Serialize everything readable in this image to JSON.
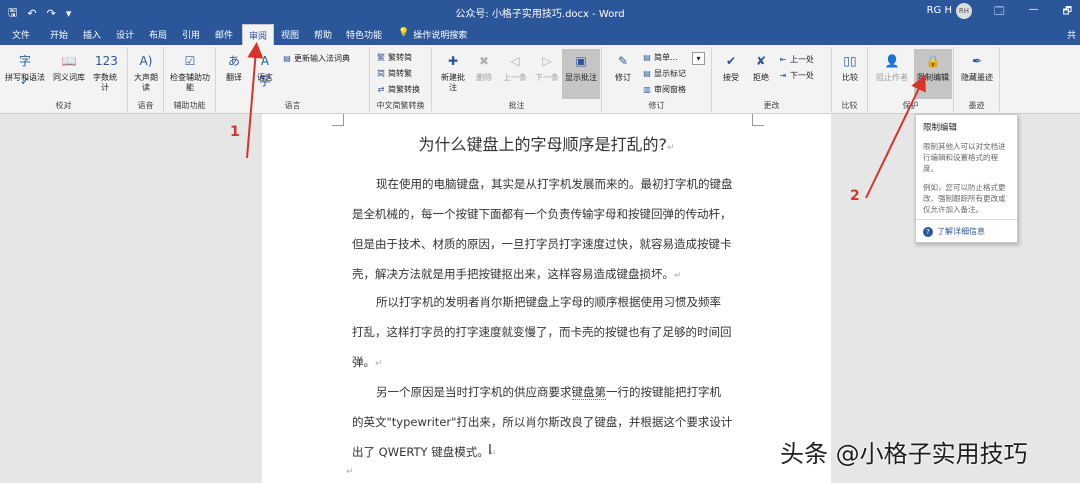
{
  "titlebar": {
    "qat": [
      "🖫",
      "↶",
      "↷",
      "▾"
    ],
    "title": "公众号: 小格子实用技巧.docx - Word",
    "user": "RG H",
    "avatar": "RH",
    "win": [
      "🗔",
      "—",
      "🗗"
    ]
  },
  "tabs": [
    "文件",
    "开始",
    "插入",
    "设计",
    "布局",
    "引用",
    "邮件",
    "审阅",
    "视图",
    "帮助",
    "特色功能"
  ],
  "tell_me": {
    "icon": "💡",
    "label": "操作说明搜索"
  },
  "share": "共",
  "ribbon": {
    "proofing": {
      "label": "校对",
      "buttons": [
        "拼写和语法",
        "同义词库",
        "字数统计"
      ]
    },
    "speech": {
      "label": "语音",
      "buttons": [
        "大声朗读"
      ]
    },
    "accessibility": {
      "label": "辅助功能",
      "buttons": [
        "检查辅助功能"
      ]
    },
    "language": {
      "label": "语言",
      "buttons": [
        "翻译",
        "语言"
      ],
      "update_ime": "更新输入法词典"
    },
    "chinese": {
      "label": "中文简繁转换",
      "buttons": [
        "繁转简",
        "简转繁",
        "简繁转换"
      ]
    },
    "comments": {
      "label": "批注",
      "buttons": [
        "新建批注",
        "删除",
        "上一条",
        "下一条",
        "显示批注"
      ]
    },
    "tracking": {
      "label": "修订",
      "buttons": [
        "修订"
      ],
      "markup": "简单...",
      "show_markup": "显示标记",
      "pane": "审阅窗格"
    },
    "changes": {
      "label": "更改",
      "buttons": [
        "接受",
        "拒绝"
      ],
      "prev": "上一处",
      "next": "下一处"
    },
    "compare": {
      "label": "比较",
      "buttons": [
        "比较"
      ]
    },
    "protect": {
      "label": "保护",
      "buttons": [
        "阻止作者",
        "限制编辑"
      ]
    },
    "ink": {
      "label": "墨迹",
      "buttons": [
        "隐藏墨迹"
      ]
    }
  },
  "document": {
    "title": "为什么键盘上的字母顺序是打乱的?",
    "p1": [
      "现在使用的电脑键盘，其实是从打字机发展而来的。最初打字机的键盘",
      "是全机械的，每一个按键下面都有一个负责传输字母和按键回弹的传动杆，",
      "但是由于技术、材质的原因，一旦打字员打字速度过快，就容易造成按键卡",
      "壳，解决方法就是用手把按键抠出来，这样容易造成键盘损坏。"
    ],
    "p2": [
      "所以打字机的发明者肖尔斯把键盘上字母的顺序根据使用习惯及频率",
      "打乱，这样打字员的打字速度就变慢了，而卡壳的按键也有了足够的时间回",
      "弹。"
    ],
    "p3": [
      "另一个原因是当时打字机的供应商要求",
      "键盘第",
      "一行的按键能把打字机",
      "的英文\"typewriter\"打出来，所以肖尔斯改良了键盘，并根据这个要求设计",
      "出了 QWERTY 键盘模式。"
    ],
    "para_mark": "↵"
  },
  "tooltip": {
    "title": "限制编辑",
    "desc1": "限制其他人可以对文档进行编辑和设置格式的程度。",
    "desc2": "例如，您可以防止格式更改、强制跟踪所有更改或仅允许加入备注。",
    "link_icon": "?",
    "link": "了解详细信息"
  },
  "annotations": {
    "one": "1",
    "two": "2",
    "arrow_color": "#d9322b"
  },
  "watermark": "头条 @小格子实用技巧"
}
